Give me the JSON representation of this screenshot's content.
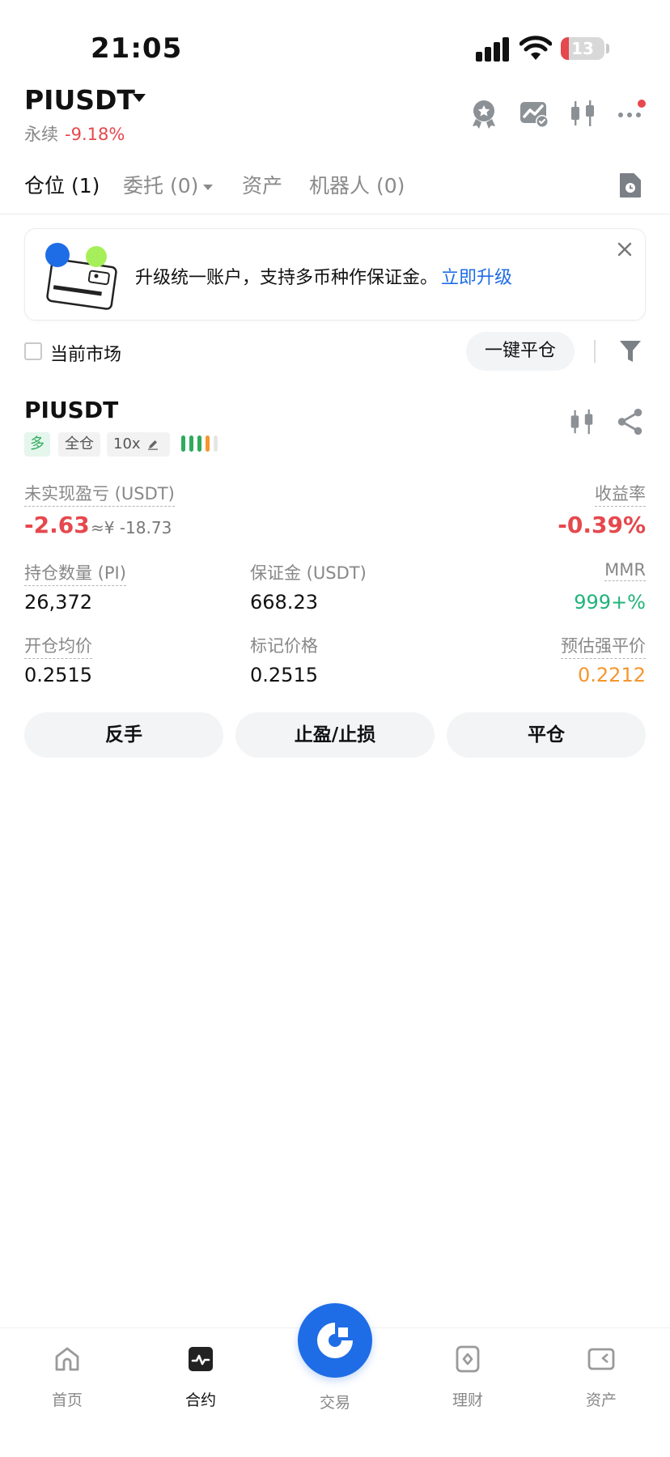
{
  "status_bar": {
    "time": "21:05",
    "battery_level": "13",
    "battery_fraction": 0.13,
    "battery_color": "#e5484d"
  },
  "header": {
    "pair": "PIUSDT",
    "contract_type": "永续",
    "change": "-9.18%",
    "icons": [
      "award-icon",
      "chart-check-icon",
      "candlestick-icon",
      "more-icon"
    ],
    "notification_dot_color": "#e5484d"
  },
  "tabs": [
    {
      "label": "仓位 (1)",
      "active": true
    },
    {
      "label": "委托 (0)",
      "active": false,
      "has_dropdown": true
    },
    {
      "label": "资产",
      "active": false
    },
    {
      "label": "机器人 (0)",
      "active": false
    }
  ],
  "banner": {
    "text": "升级统一账户，支持多币种作保证金。",
    "link": "立即升级"
  },
  "filter_row": {
    "checkbox_label": "当前市场",
    "close_all": "一键平仓"
  },
  "position": {
    "symbol": "PIUSDT",
    "side": "多",
    "margin_mode": "全仓",
    "leverage": "10x",
    "unrealized_pnl_label": "未实现盈亏 (USDT)",
    "unrealized_pnl": "-2.63",
    "unrealized_pnl_cny": "≈¥ -18.73",
    "roe_label": "收益率",
    "roe": "-0.39%",
    "size_label": "持仓数量 (PI)",
    "size": "26,372",
    "margin_label": "保证金 (USDT)",
    "margin": "668.23",
    "mmr_label": "MMR",
    "mmr": "999+%",
    "entry_label": "开仓均价",
    "entry": "0.2515",
    "mark_label": "标记价格",
    "mark": "0.2515",
    "liq_label": "预估强平价",
    "liq": "0.2212"
  },
  "actions": {
    "reverse": "反手",
    "tpsl": "止盈/止损",
    "close": "平仓"
  },
  "colors": {
    "negative": "#e5484d",
    "positive": "#21b37a",
    "warning": "#f5962e",
    "accent": "#1f6de6"
  },
  "bottom_nav": {
    "home": "首页",
    "futures": "合约",
    "trade": "交易",
    "earn": "理财",
    "assets": "资产"
  }
}
